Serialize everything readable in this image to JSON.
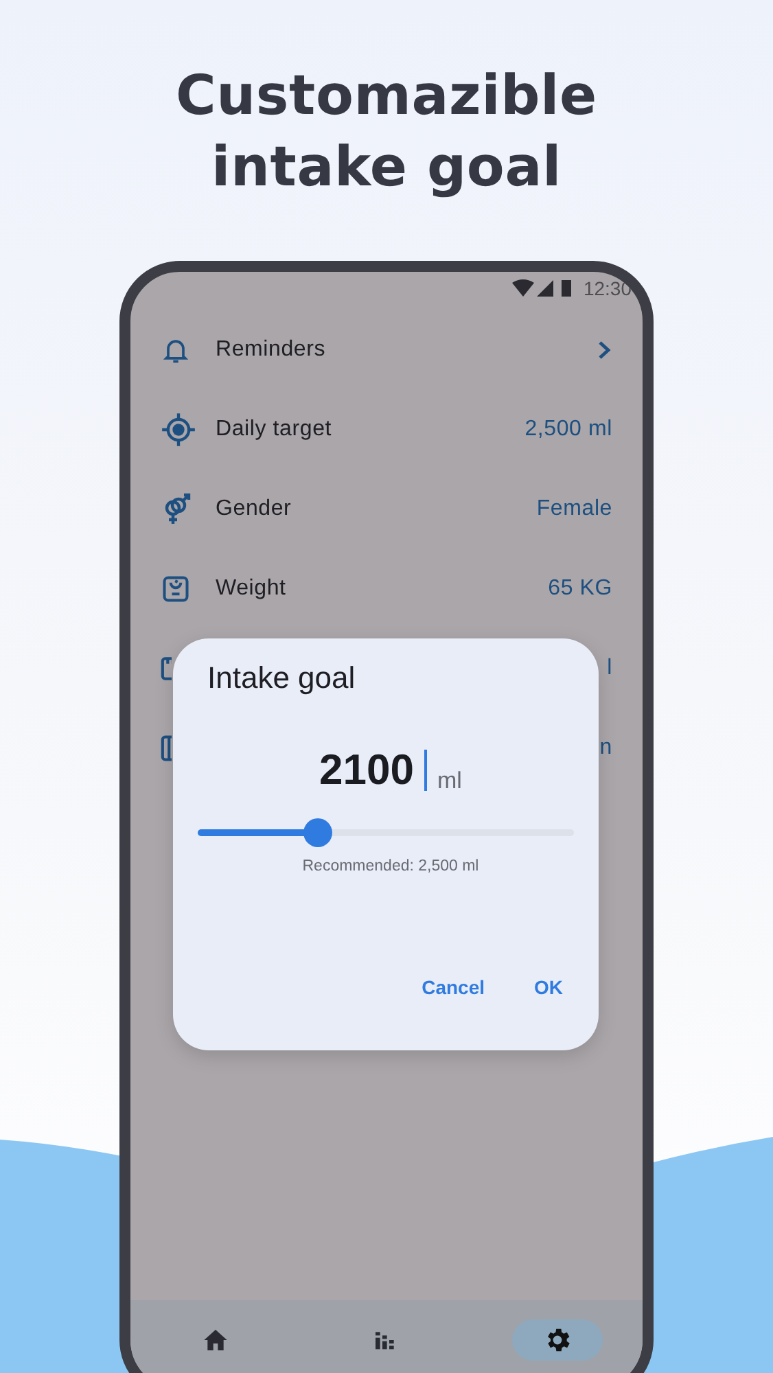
{
  "headline": "Customazible intake goal",
  "status_bar": {
    "time": "12:30"
  },
  "settings": [
    {
      "kind": "link",
      "label": "Reminders"
    },
    {
      "kind": "value",
      "label": "Daily target",
      "value": "2,500 ml"
    },
    {
      "kind": "value",
      "label": "Gender",
      "value": "Female"
    },
    {
      "kind": "value",
      "label": "Weight",
      "value": "65 KG"
    },
    {
      "kind": "covered",
      "value": "l"
    },
    {
      "kind": "covered",
      "value": "n"
    }
  ],
  "dialog": {
    "title": "Intake goal",
    "value": "2100",
    "unit": "ml",
    "slider": {
      "level": 0.32
    },
    "hint": "Recommended: 2,500 ml",
    "buttons": [
      "Cancel",
      "OK"
    ]
  },
  "nav": [
    {
      "kind": "home",
      "selected": false
    },
    {
      "kind": "stats",
      "selected": false
    },
    {
      "kind": "settings",
      "selected": true
    }
  ]
}
